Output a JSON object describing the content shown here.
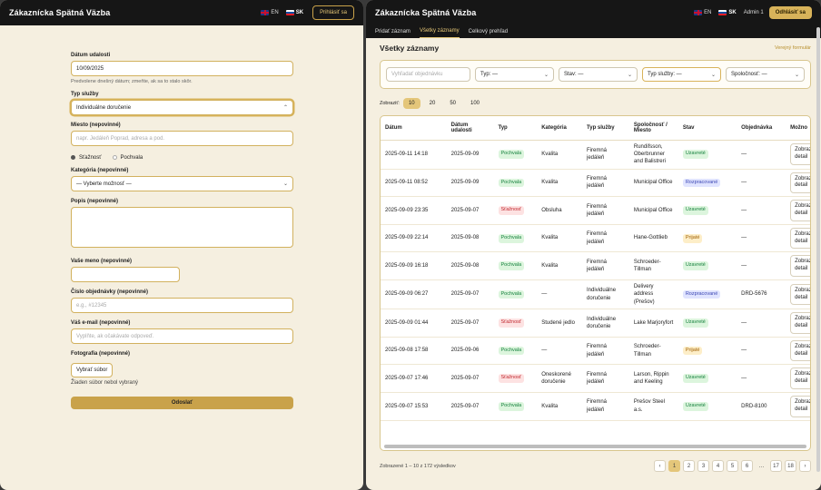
{
  "left": {
    "brand": "Zákaznícka Spätná Väzba",
    "lang_en": "EN",
    "lang_sk": "SK",
    "login": "Prihlásiť sa",
    "form": {
      "date_label": "Dátum udalosti",
      "date_value": "10/09/2025",
      "date_hint": "Predvolene dnešný dátum; zmeňte, ak sa to stalo skôr.",
      "service_label": "Typ služby",
      "service_value": "Individuálne doručenie",
      "place_label": "Miesto (nepovinné)",
      "place_placeholder": "napr. Jedáleň Poprad, adresa a pod.",
      "radio_complaint": "Sťažnosť",
      "radio_praise": "Pochvala",
      "category_label": "Kategória (nepovinné)",
      "category_value": "— Vyberte možnosť —",
      "desc_label": "Popis (nepovinné)",
      "name_label": "Vaše meno (nepovinné)",
      "order_label": "Číslo objednávky (nepovinné)",
      "order_placeholder": "e.g., #12345",
      "email_label": "Váš e-mail (nepovinné)",
      "email_placeholder": "Vyplňte, ak očakávate odpoveď.",
      "photo_label": "Fotografia (nepovinné)",
      "photo_button": "Vybrať súbor",
      "photo_status": "Žiaden súbor nebol vybraný",
      "submit": "Odoslať"
    }
  },
  "right": {
    "brand": "Zákaznícka Spätná Väzba",
    "lang_en": "EN",
    "lang_sk": "SK",
    "admin": "Admin 1",
    "logout": "Odhlásiť sa",
    "tabs": [
      "Pridať záznam",
      "Všetky záznamy",
      "Celkový prehľad"
    ],
    "title": "Všetky záznamy",
    "public_link": "Verejný formulár",
    "filters": {
      "search_placeholder": "Vyhľadať objednávku",
      "type": "Typ: —",
      "status": "Stav: —",
      "service": "Typ služby: —",
      "company": "Spoločnosť: —"
    },
    "pagesize_label": "Zobraziť:",
    "pagesizes": [
      "10",
      "20",
      "50",
      "100"
    ],
    "columns": [
      "Dátum",
      "Dátum udalosti",
      "Typ",
      "Kategória",
      "Typ služby",
      "Spoločnosť / Miesto",
      "Stav",
      "Objednávka",
      "Možno"
    ],
    "rows": [
      {
        "date": "2025-09-11 14:18",
        "event": "2025-09-09",
        "type": "Pochvala",
        "cat": "Kvalita",
        "service": "Firemná jedáleň",
        "company": "Rundifsson, Oberbrunner and Balistreri",
        "status": "Uzavreté",
        "order": "—"
      },
      {
        "date": "2025-09-11 08:52",
        "event": "2025-09-09",
        "type": "Pochvala",
        "cat": "Kvalita",
        "service": "Firemná jedáleň",
        "company": "Municipal Office",
        "status": "Rozpracované",
        "order": "—"
      },
      {
        "date": "2025-09-09 23:35",
        "event": "2025-09-07",
        "type": "Sťažnosť",
        "cat": "Obsluha",
        "service": "Firemná jedáleň",
        "company": "Municipal Office",
        "status": "Uzavreté",
        "order": "—"
      },
      {
        "date": "2025-09-09 22:14",
        "event": "2025-09-08",
        "type": "Pochvala",
        "cat": "Kvalita",
        "service": "Firemná jedáleň",
        "company": "Hane-Gottlieb",
        "status": "Prijaté",
        "order": "—"
      },
      {
        "date": "2025-09-09 16:18",
        "event": "2025-09-08",
        "type": "Pochvala",
        "cat": "Kvalita",
        "service": "Firemná jedáleň",
        "company": "Schroeder-Tillman",
        "status": "Uzavreté",
        "order": "—"
      },
      {
        "date": "2025-09-09 06:27",
        "event": "2025-09-07",
        "type": "Pochvala",
        "cat": "—",
        "service": "Individuálne doručenie",
        "company": "Delivery address (Prešov)",
        "status": "Rozpracované",
        "order": "DRD-5676"
      },
      {
        "date": "2025-09-09 01:44",
        "event": "2025-09-07",
        "type": "Sťažnosť",
        "cat": "Studené jedlo",
        "service": "Individuálne doručenie",
        "company": "Lake Marjoryfort",
        "status": "Uzavreté",
        "order": "—"
      },
      {
        "date": "2025-09-08 17:58",
        "event": "2025-09-06",
        "type": "Pochvala",
        "cat": "—",
        "service": "Firemná jedáleň",
        "company": "Schroeder-Tillman",
        "status": "Prijaté",
        "order": "—"
      },
      {
        "date": "2025-09-07 17:46",
        "event": "2025-09-07",
        "type": "Sťažnosť",
        "cat": "Oneskorené doručenie",
        "service": "Firemná jedáleň",
        "company": "Larson, Rippin and Keeling",
        "status": "Uzavreté",
        "order": "—"
      },
      {
        "date": "2025-09-07 15:53",
        "event": "2025-09-07",
        "type": "Pochvala",
        "cat": "Kvalita",
        "service": "Firemná jedáleň",
        "company": "Prešov Steel a.s.",
        "status": "Uzavreté",
        "order": "DRD-8100"
      }
    ],
    "detail_label": "Zobraziť detail",
    "footer_text": "Zobrazené 1 – 10 z 172 výsledkov",
    "pages": [
      "‹",
      "1",
      "2",
      "3",
      "4",
      "5",
      "6",
      "…",
      "17",
      "18",
      "›"
    ]
  }
}
